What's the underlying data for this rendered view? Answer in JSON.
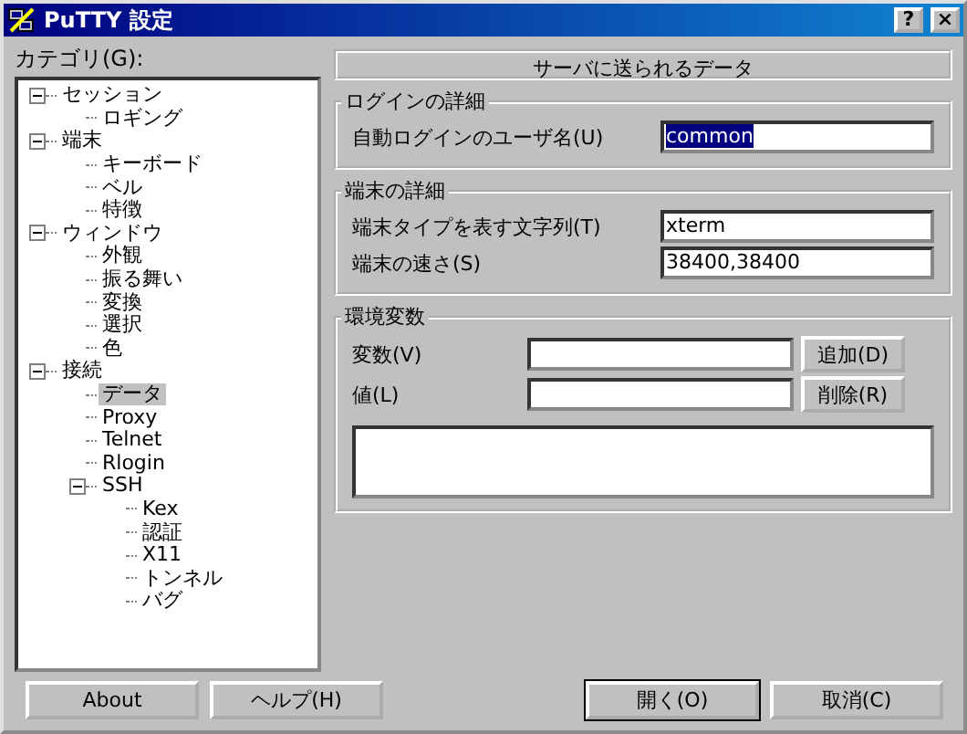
{
  "window": {
    "title": "PuTTY 設定",
    "title_buttons": [
      "?",
      "×"
    ]
  },
  "category_label": "カテゴリ(G):",
  "tree": [
    {
      "label": "セッション",
      "selected": false,
      "expanded": true,
      "children": [
        {
          "label": "ロギング",
          "selected": false
        }
      ]
    },
    {
      "label": "端末",
      "selected": false,
      "expanded": true,
      "children": [
        {
          "label": "キーボード",
          "selected": false
        },
        {
          "label": "ベル",
          "selected": false
        },
        {
          "label": "特徴",
          "selected": false
        }
      ]
    },
    {
      "label": "ウィンドウ",
      "selected": false,
      "expanded": true,
      "children": [
        {
          "label": "外観",
          "selected": false
        },
        {
          "label": "振る舞い",
          "selected": false
        },
        {
          "label": "変換",
          "selected": false
        },
        {
          "label": "選択",
          "selected": false
        },
        {
          "label": "色",
          "selected": false
        }
      ]
    },
    {
      "label": "接続",
      "selected": false,
      "expanded": true,
      "children": [
        {
          "label": "データ",
          "selected": true
        },
        {
          "label": "Proxy",
          "selected": false
        },
        {
          "label": "Telnet",
          "selected": false
        },
        {
          "label": "Rlogin",
          "selected": false
        },
        {
          "label": "SSH",
          "selected": false,
          "expanded": true,
          "children": [
            {
              "label": "Kex",
              "selected": false
            },
            {
              "label": "認証",
              "selected": false
            },
            {
              "label": "X11",
              "selected": false
            },
            {
              "label": "トンネル",
              "selected": false
            },
            {
              "label": "バグ",
              "selected": false
            }
          ]
        }
      ]
    }
  ],
  "panel_header": "サーバに送られるデータ",
  "login_group": {
    "title": "ログインの詳細",
    "label": "自動ログインのユーザ名(U)",
    "value": "common",
    "text_selected": true
  },
  "terminal_group": {
    "title": "端末の詳細",
    "fields": [
      {
        "label": "端末タイプを表す文字列(T)",
        "value": "xterm"
      },
      {
        "label": "端末の速さ(S)",
        "value": "38400,38400"
      }
    ]
  },
  "env_group": {
    "title": "環境変数",
    "variable_label": "変数(V)",
    "value_label": "値(L)",
    "add_button": "追加(D)",
    "remove_button": "削除(R)"
  },
  "left_buttons": [
    "About",
    "ヘルプ(H)"
  ],
  "right_buttons": [
    "開く(O)",
    "取消(C)"
  ]
}
